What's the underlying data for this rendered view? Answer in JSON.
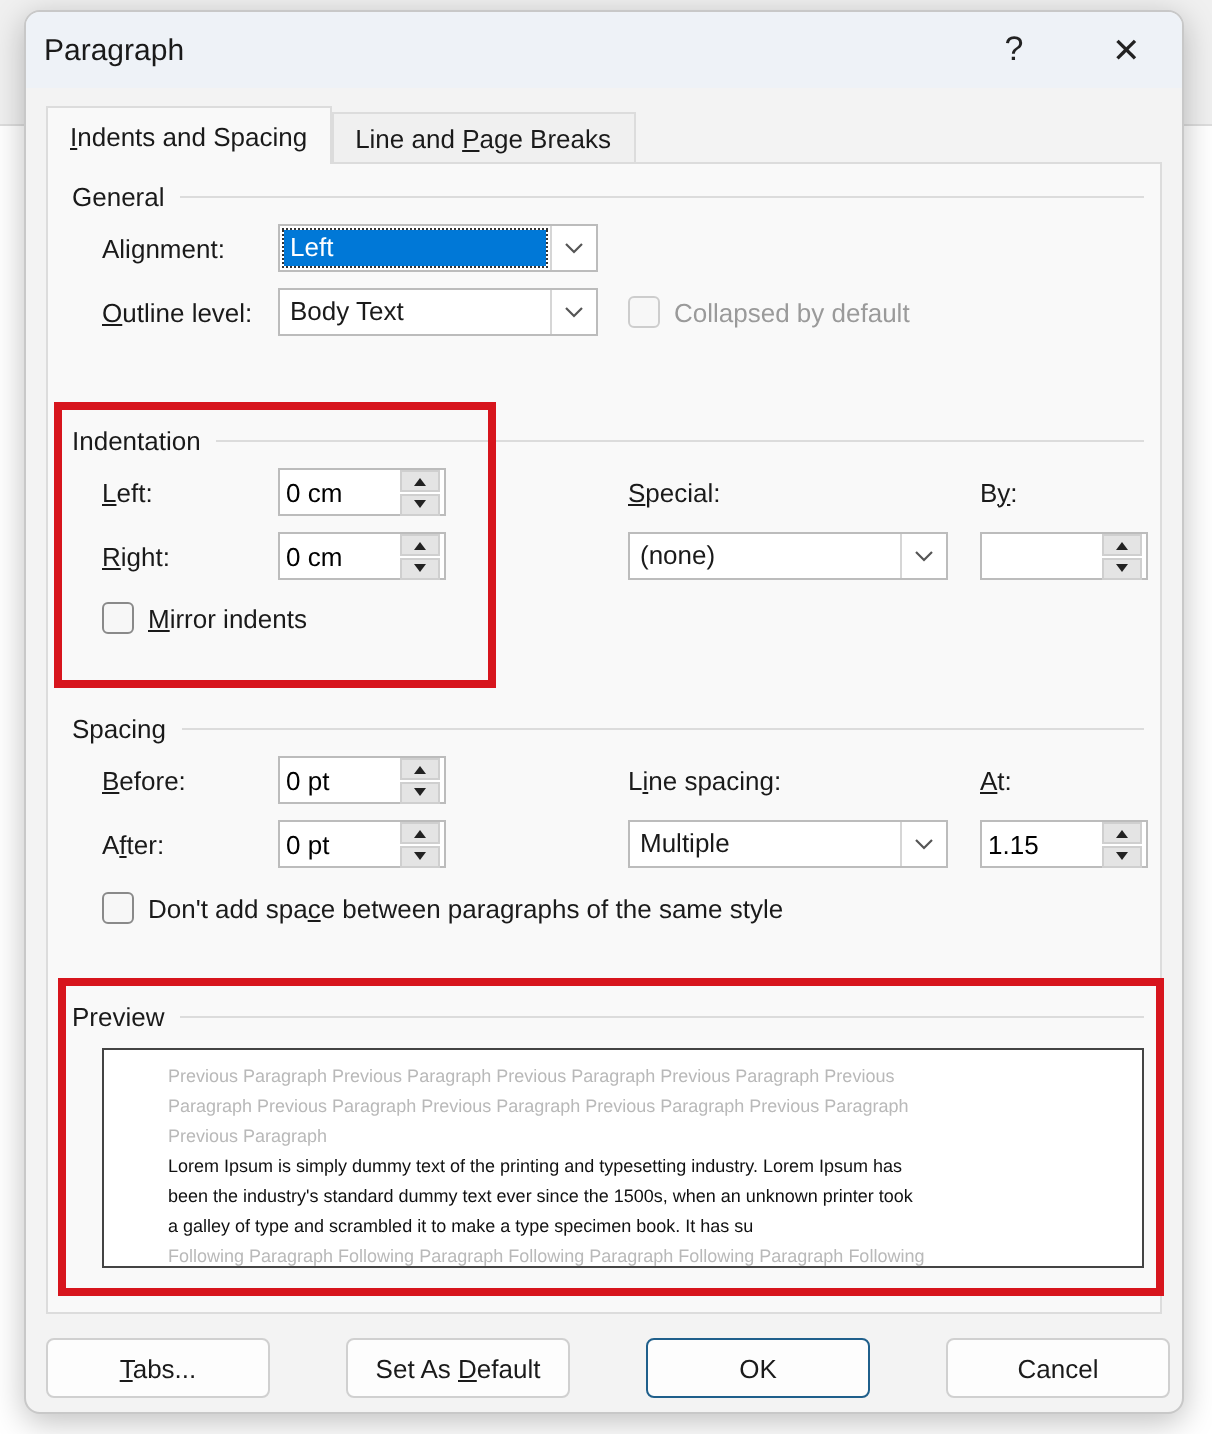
{
  "window": {
    "title": "Paragraph",
    "help": "?",
    "close": "✕"
  },
  "tabs": [
    {
      "label": {
        "key": "I",
        "post": "ndents and Spacing"
      },
      "selected": true
    },
    {
      "label": {
        "pre": "Line and ",
        "key": "P",
        "post": "age Breaks"
      },
      "selected": false
    }
  ],
  "general": {
    "title": "General",
    "alignment": {
      "label": {
        "pre": "Ali",
        "key": "g",
        "post": "nment:"
      },
      "value": "Left",
      "focused": true
    },
    "outline_level": {
      "label": {
        "key": "O",
        "post": "utline level:"
      },
      "value": "Body Text"
    },
    "collapsed": {
      "label": "Collapsed by default",
      "checked": false,
      "disabled": true
    }
  },
  "indentation": {
    "title": "Indentation",
    "highlight": true,
    "left": {
      "label": {
        "key": "L",
        "post": "eft:"
      },
      "value": "0 cm"
    },
    "right": {
      "label": {
        "key": "R",
        "post": "ight:"
      },
      "value": "0 cm"
    },
    "special": {
      "label": {
        "key": "S",
        "post": "pecial:"
      },
      "value": "(none)"
    },
    "by": {
      "label": {
        "pre": "B",
        "key": "y",
        "post": ":"
      }
    },
    "mirror": {
      "label": {
        "key": "M",
        "post": "irror indents"
      },
      "checked": false
    }
  },
  "spacing": {
    "title": "Spacing",
    "before": {
      "label": {
        "key": "B",
        "post": "efore:"
      },
      "value": "0 pt"
    },
    "after": {
      "label": {
        "pre": "A",
        "key": "f",
        "post": "ter:"
      },
      "value": "0 pt"
    },
    "line_spacing": {
      "label": {
        "pre": "L",
        "key": "i",
        "post": "ne spacing:"
      },
      "value": "Multiple"
    },
    "at": {
      "label": {
        "key": "A",
        "post": "t:"
      },
      "value": "1.15"
    },
    "dont_add": {
      "label": {
        "pre": "Don't add spa",
        "key": "c",
        "post": "e between paragraphs of the same style"
      },
      "checked": false
    }
  },
  "preview": {
    "title": "Preview",
    "highlight": true,
    "lines": [
      {
        "kind": "context",
        "text": "Previous Paragraph Previous Paragraph Previous Paragraph Previous Paragraph Previous"
      },
      {
        "kind": "context",
        "text": "Paragraph Previous Paragraph Previous Paragraph Previous Paragraph Previous Paragraph"
      },
      {
        "kind": "context",
        "text": "Previous Paragraph"
      },
      {
        "kind": "sample",
        "text": "Lorem Ipsum is simply dummy text of the printing and typesetting industry. Lorem Ipsum has"
      },
      {
        "kind": "sample",
        "text": "been the industry's standard dummy text ever since the 1500s, when an unknown printer took"
      },
      {
        "kind": "sample",
        "text": "a galley of type and scrambled it to make a type specimen book. It has su"
      },
      {
        "kind": "context",
        "text": "Following Paragraph Following Paragraph Following Paragraph Following Paragraph Following"
      }
    ]
  },
  "buttons": [
    {
      "label": {
        "key": "T",
        "post": "abs..."
      },
      "default": false
    },
    {
      "label": {
        "pre": "Set As ",
        "key": "D",
        "post": "efault"
      },
      "default": false
    },
    {
      "label": {
        "pre": "OK"
      },
      "default": true
    },
    {
      "label": {
        "pre": "Cancel"
      },
      "default": false
    }
  ]
}
